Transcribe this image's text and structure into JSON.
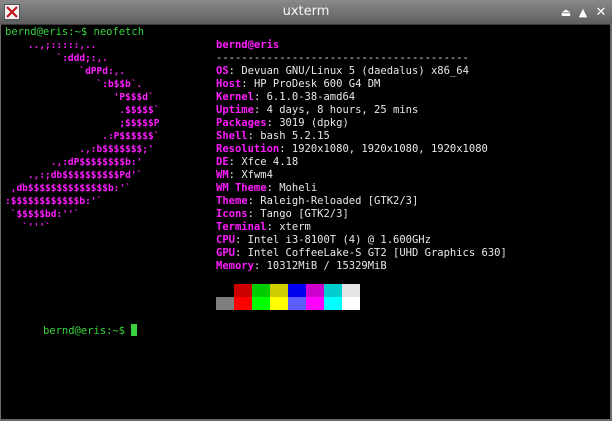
{
  "window": {
    "title": "uxterm",
    "min_glyph": "⏏",
    "max_glyph": "▲",
    "close_glyph": "✕"
  },
  "prompt": {
    "first": "bernd@eris:~$ neofetch",
    "second": "bernd@eris:~$ "
  },
  "ascii_art": [
    "    ..,;:::::,..",
    "         `:ddd;:,.",
    "             `dPPd:,.",
    "                `:b$$b`.",
    "                   'P$$$d`",
    "                    .$$$$$`",
    "                    ;$$$$$P",
    "                 .:P$$$$$$`",
    "             .,:b$$$$$$$;'",
    "        .,:dP$$$$$$$$b:'",
    "    .,:;db$$$$$$$$$$Pd'`",
    " ,db$$$$$$$$$$$$$$b:'`",
    ":$$$$$$$$$$$$b:'`",
    " `$$$$$bd:''`",
    "   `'''`"
  ],
  "user_host": "bernd@eris",
  "separator": "----------------------------------------",
  "info": [
    {
      "key": "OS",
      "value": "Devuan GNU/Linux 5 (daedalus) x86_64"
    },
    {
      "key": "Host",
      "value": "HP ProDesk 600 G4 DM"
    },
    {
      "key": "Kernel",
      "value": "6.1.0-38-amd64"
    },
    {
      "key": "Uptime",
      "value": "4 days, 8 hours, 25 mins"
    },
    {
      "key": "Packages",
      "value": "3019 (dpkg)"
    },
    {
      "key": "Shell",
      "value": "bash 5.2.15"
    },
    {
      "key": "Resolution",
      "value": "1920x1080, 1920x1080, 1920x1080"
    },
    {
      "key": "DE",
      "value": "Xfce 4.18"
    },
    {
      "key": "WM",
      "value": "Xfwm4"
    },
    {
      "key": "WM Theme",
      "value": "Moheli"
    },
    {
      "key": "Theme",
      "value": "Raleigh-Reloaded [GTK2/3]"
    },
    {
      "key": "Icons",
      "value": "Tango [GTK2/3]"
    },
    {
      "key": "Terminal",
      "value": "xterm"
    },
    {
      "key": "CPU",
      "value": "Intel i3-8100T (4) @ 1.600GHz"
    },
    {
      "key": "GPU",
      "value": "Intel CoffeeLake-S GT2 [UHD Graphics 630]"
    },
    {
      "key": "Memory",
      "value": "10312MiB / 15329MiB"
    }
  ],
  "palette": {
    "top": [
      "#000000",
      "#cd0000",
      "#00cd00",
      "#cdcd00",
      "#0000ee",
      "#cd00cd",
      "#00cdcd",
      "#e5e5e5"
    ],
    "bottom": [
      "#7f7f7f",
      "#ff0000",
      "#00ff00",
      "#ffff00",
      "#5c5cff",
      "#ff00ff",
      "#00ffff",
      "#ffffff"
    ]
  }
}
